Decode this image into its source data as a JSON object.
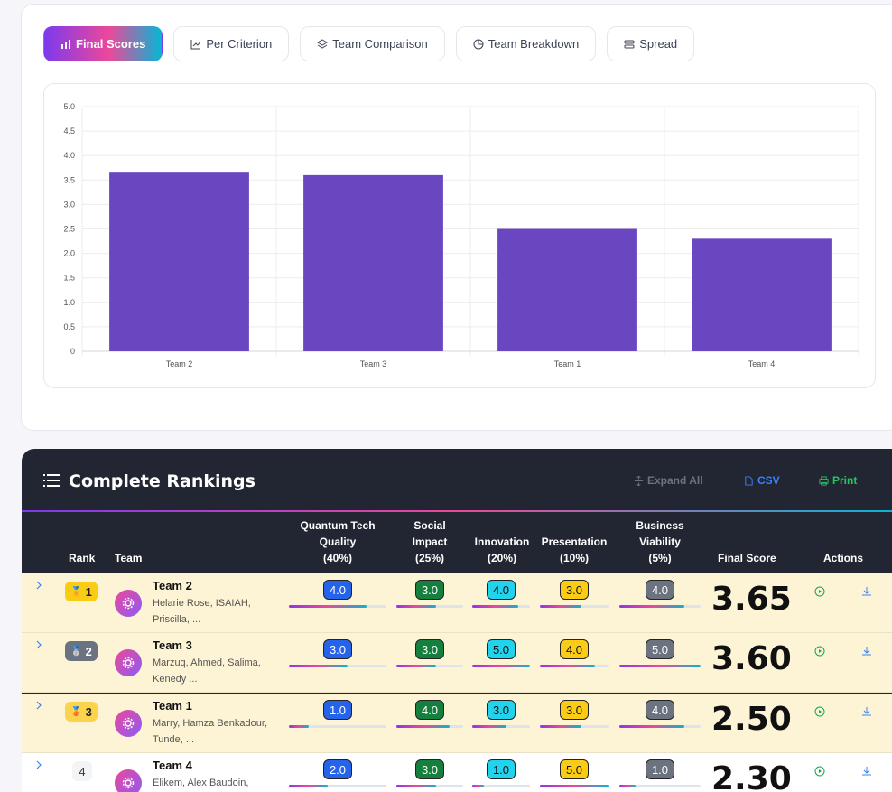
{
  "tabs": [
    {
      "label": "Final Scores",
      "icon": "bar-chart-icon",
      "active": true
    },
    {
      "label": "Per Criterion",
      "icon": "line-chart-icon",
      "active": false
    },
    {
      "label": "Team Comparison",
      "icon": "layers-icon",
      "active": false
    },
    {
      "label": "Team Breakdown",
      "icon": "pie-chart-icon",
      "active": false
    },
    {
      "label": "Spread",
      "icon": "stack-icon",
      "active": false
    }
  ],
  "chart_data": {
    "type": "bar",
    "categories": [
      "Team 2",
      "Team 3",
      "Team 1",
      "Team 4"
    ],
    "values": [
      3.65,
      3.6,
      2.5,
      2.3
    ],
    "ylim": [
      0,
      5
    ],
    "yticks": [
      "0",
      "0.5",
      "1.0",
      "1.5",
      "2.0",
      "2.5",
      "3.0",
      "3.5",
      "4.0",
      "4.5",
      "5.0"
    ],
    "bar_color": "#6b46c1",
    "grid": true,
    "legend": "none"
  },
  "rankings": {
    "title": "Complete Rankings",
    "expand_all": "Expand All",
    "csv": "CSV",
    "print": "Print",
    "columns": {
      "rank": "Rank",
      "team": "Team",
      "c1": [
        "Quantum Tech",
        "Quality",
        "(40%)"
      ],
      "c2": [
        "Social",
        "Impact",
        "(25%)"
      ],
      "c3": [
        "Innovation",
        "(20%)"
      ],
      "c4": [
        "Presentation",
        "(10%)"
      ],
      "c5": [
        "Business",
        "Viability",
        "(5%)"
      ],
      "final": "Final Score",
      "actions": "Actions"
    },
    "rows": [
      {
        "rank": "1",
        "medal": "gold",
        "team": "Team 2",
        "members": "Helarie Rose, ISAIAH, Priscilla, ...",
        "scores": [
          "4.0",
          "3.0",
          "4.0",
          "3.0",
          "4.0"
        ],
        "final": "3.65"
      },
      {
        "rank": "2",
        "medal": "silver",
        "team": "Team 3",
        "members": "Marzuq, Ahmed, Salima, Kenedy ...",
        "scores": [
          "3.0",
          "3.0",
          "5.0",
          "4.0",
          "5.0"
        ],
        "final": "3.60"
      },
      {
        "rank": "3",
        "medal": "bronze",
        "team": "Team 1",
        "members": "Marry, Hamza Benkadour, Tunde, ...",
        "scores": [
          "1.0",
          "4.0",
          "3.0",
          "3.0",
          "4.0"
        ],
        "final": "2.50"
      },
      {
        "rank": "4",
        "medal": "none",
        "team": "Team 4",
        "members": "Elikem, Alex Baudoin,",
        "scores": [
          "2.0",
          "3.0",
          "1.0",
          "5.0",
          "1.0"
        ],
        "final": "2.30"
      }
    ]
  },
  "colors": {
    "accent_purple": "#7c3aed",
    "accent_pink": "#ec4899",
    "accent_cyan": "#06b6d4",
    "csv_blue": "#3b82f6",
    "print_green": "#22c55e"
  }
}
